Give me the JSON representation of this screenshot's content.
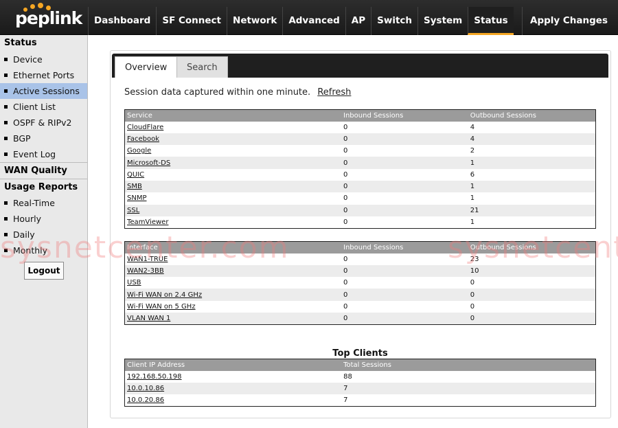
{
  "brand": {
    "logo_text": "peplink",
    "accent": "#f5a623"
  },
  "nav": {
    "items": [
      "Dashboard",
      "SF Connect",
      "Network",
      "Advanced",
      "AP",
      "Switch",
      "System",
      "Status"
    ],
    "active": "Status",
    "apply_label": "Apply Changes"
  },
  "sidebar": {
    "status_head": "Status",
    "status_items": [
      "Device",
      "Ethernet Ports",
      "Active Sessions",
      "Client List",
      "OSPF & RIPv2",
      "BGP",
      "Event Log"
    ],
    "active_item": "Active Sessions",
    "wan_quality_head": "WAN Quality",
    "usage_head": "Usage Reports",
    "usage_items": [
      "Real-Time",
      "Hourly",
      "Daily",
      "Monthly"
    ],
    "logout_label": "Logout"
  },
  "tabs": {
    "overview": "Overview",
    "search": "Search"
  },
  "session_note": "Session data captured within one minute.",
  "refresh_label": "Refresh",
  "services_table": {
    "headers": [
      "Service",
      "Inbound Sessions",
      "Outbound Sessions"
    ],
    "rows": [
      [
        "CloudFlare",
        "0",
        "4"
      ],
      [
        "Facebook",
        "0",
        "4"
      ],
      [
        "Google",
        "0",
        "2"
      ],
      [
        "Microsoft-DS",
        "0",
        "1"
      ],
      [
        "QUIC",
        "0",
        "6"
      ],
      [
        "SMB",
        "0",
        "1"
      ],
      [
        "SNMP",
        "0",
        "1"
      ],
      [
        "SSL",
        "0",
        "21"
      ],
      [
        "TeamViewer",
        "0",
        "1"
      ]
    ]
  },
  "interface_table": {
    "headers": [
      "Interface",
      "Inbound Sessions",
      "Outbound Sessions"
    ],
    "rows": [
      [
        "WAN1-TRUE",
        "0",
        "23"
      ],
      [
        "WAN2-3BB",
        "0",
        "10"
      ],
      [
        "USB",
        "0",
        "0"
      ],
      [
        "Wi-Fi WAN on 2.4 GHz",
        "0",
        "0"
      ],
      [
        "Wi-Fi WAN on 5 GHz",
        "0",
        "0"
      ],
      [
        "VLAN WAN 1",
        "0",
        "0"
      ]
    ]
  },
  "top_clients": {
    "title": "Top Clients",
    "headers": [
      "Client IP Address",
      "Total Sessions"
    ],
    "rows": [
      [
        "192.168.50.198",
        "88"
      ],
      [
        "10.0.10.86",
        "7"
      ],
      [
        "10.0.20.86",
        "7"
      ]
    ]
  },
  "watermark": "sysnetcenter.com"
}
